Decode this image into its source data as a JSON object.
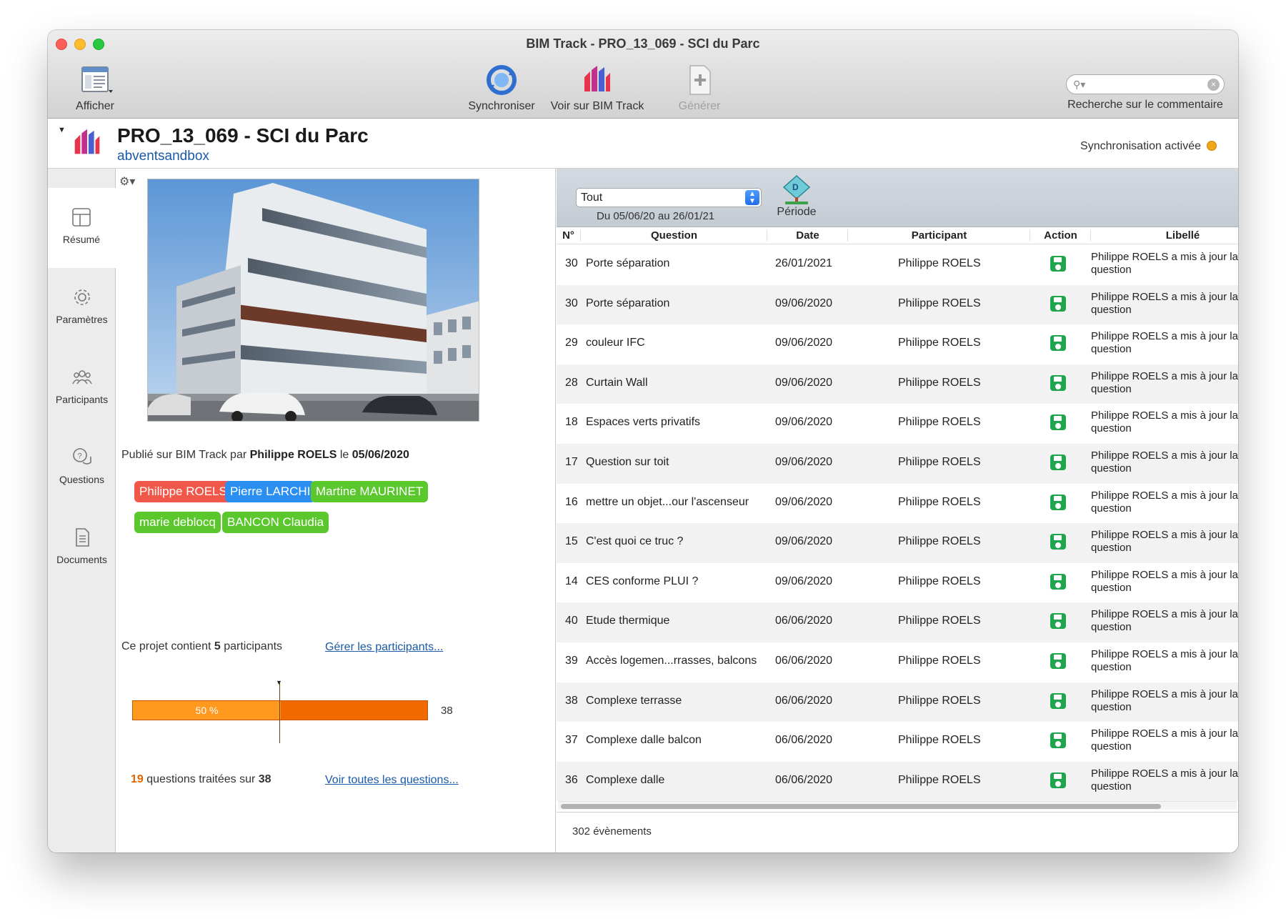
{
  "window": {
    "title": "BIM Track - PRO_13_069 - SCI du Parc"
  },
  "toolbar": {
    "afficher": "Afficher",
    "synchroniser": "Synchroniser",
    "voir": "Voir sur BIM Track",
    "generer": "Générer",
    "search_label": "Recherche sur le commentaire",
    "search_value": ""
  },
  "header": {
    "title": "PRO_13_069 - SCI du Parc",
    "subtitle": "abventsandbox",
    "sync_status": "Synchronisation activée"
  },
  "nav": [
    {
      "label": "Résumé",
      "icon": "layout-icon",
      "active": true
    },
    {
      "label": "Paramètres",
      "icon": "gear-icon",
      "active": false
    },
    {
      "label": "Participants",
      "icon": "people-icon",
      "active": false
    },
    {
      "label": "Questions",
      "icon": "chat-question-icon",
      "active": false
    },
    {
      "label": "Documents",
      "icon": "document-icon",
      "active": false
    }
  ],
  "summary": {
    "published_prefix": "Publié sur BIM Track par",
    "published_by": "Philippe ROELS",
    "published_mid": "le",
    "published_date": "05/06/2020",
    "participants": [
      {
        "name": "Philippe ROELS",
        "color": "#f2584a"
      },
      {
        "name": "Pierre LARCHI",
        "color": "#2a8ff0"
      },
      {
        "name": "Martine MAURINET",
        "color": "#5ac82d"
      },
      {
        "name": "marie deblocq",
        "color": "#5ac82d"
      },
      {
        "name": "BANCON Claudia",
        "color": "#5ac82d"
      }
    ],
    "count_prefix": "Ce projet contient",
    "count": "5",
    "count_suffix": "participants",
    "manage_link": "Gérer les participants...",
    "progress_label": "50 %",
    "progress_fraction": 0.5,
    "treated_count": "19",
    "total_questions": "38",
    "treated_mid": "questions traitées sur",
    "all_questions_link": "Voir toutes les questions..."
  },
  "filter": {
    "select_value": "Tout",
    "period_range": "Du 05/06/20 au 26/01/21",
    "period_label": "Période"
  },
  "table": {
    "columns": [
      "N°",
      "Question",
      "Date",
      "Participant",
      "Action",
      "Libellé"
    ],
    "rows": [
      {
        "n": "30",
        "question": "Porte séparation",
        "date": "26/01/2021",
        "participant": "Philippe ROELS",
        "label": "Philippe ROELS a mis à jour la question"
      },
      {
        "n": "30",
        "question": "Porte séparation",
        "date": "09/06/2020",
        "participant": "Philippe ROELS",
        "label": "Philippe ROELS a mis à jour la question"
      },
      {
        "n": "29",
        "question": "couleur IFC",
        "date": "09/06/2020",
        "participant": "Philippe ROELS",
        "label": "Philippe ROELS a mis à jour la question"
      },
      {
        "n": "28",
        "question": "Curtain Wall",
        "date": "09/06/2020",
        "participant": "Philippe ROELS",
        "label": "Philippe ROELS a mis à jour la question"
      },
      {
        "n": "18",
        "question": "Espaces verts privatifs",
        "date": "09/06/2020",
        "participant": "Philippe ROELS",
        "label": "Philippe ROELS a mis à jour la question"
      },
      {
        "n": "17",
        "question": "Question sur toit",
        "date": "09/06/2020",
        "participant": "Philippe ROELS",
        "label": "Philippe ROELS a mis à jour la question"
      },
      {
        "n": "16",
        "question": "mettre un objet...our l'ascenseur",
        "date": "09/06/2020",
        "participant": "Philippe ROELS",
        "label": "Philippe ROELS a mis à jour la question"
      },
      {
        "n": "15",
        "question": "C'est quoi ce truc ?",
        "date": "09/06/2020",
        "participant": "Philippe ROELS",
        "label": "Philippe ROELS a mis à jour la question"
      },
      {
        "n": "14",
        "question": "CES conforme PLUI ?",
        "date": "09/06/2020",
        "participant": "Philippe ROELS",
        "label": "Philippe ROELS a mis à jour la question"
      },
      {
        "n": "40",
        "question": "Etude thermique",
        "date": "06/06/2020",
        "participant": "Philippe ROELS",
        "label": "Philippe ROELS a mis à jour la question"
      },
      {
        "n": "39",
        "question": "Accès logemen...rrasses, balcons",
        "date": "06/06/2020",
        "participant": "Philippe ROELS",
        "label": "Philippe ROELS a mis à jour la question"
      },
      {
        "n": "38",
        "question": "Complexe terrasse",
        "date": "06/06/2020",
        "participant": "Philippe ROELS",
        "label": "Philippe ROELS a mis à jour la question"
      },
      {
        "n": "37",
        "question": "Complexe dalle balcon",
        "date": "06/06/2020",
        "participant": "Philippe ROELS",
        "label": "Philippe ROELS a mis à jour la question"
      },
      {
        "n": "36",
        "question": "Complexe dalle",
        "date": "06/06/2020",
        "participant": "Philippe ROELS",
        "label": "Philippe ROELS a mis à jour la question"
      }
    ],
    "event_count": "302 évènements"
  }
}
